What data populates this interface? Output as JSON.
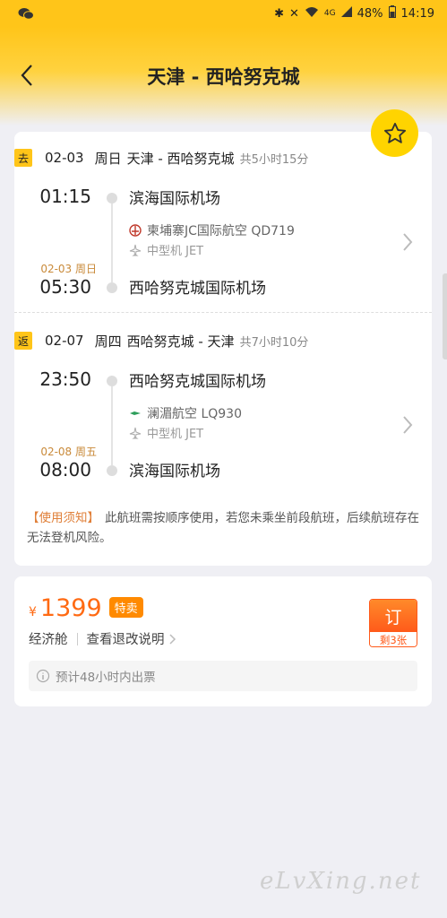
{
  "status_bar": {
    "battery": "48%",
    "time": "14:19",
    "network": "4G"
  },
  "header": {
    "title": "天津 - 西哈努克城"
  },
  "outbound": {
    "badge": "去",
    "date": "02-03",
    "weekday": "周日",
    "route": "天津 - 西哈努克城",
    "duration": "共5小时15分",
    "dep_time": "01:15",
    "dep_airport": "滨海国际机场",
    "airline": "柬埔寨JC国际航空 QD719",
    "aircraft": "中型机 JET",
    "arr_date": "02-03 周日",
    "arr_time": "05:30",
    "arr_airport": "西哈努克城国际机场"
  },
  "return": {
    "badge": "返",
    "date": "02-07",
    "weekday": "周四",
    "route": "西哈努克城 - 天津",
    "duration": "共7小时10分",
    "dep_time": "23:50",
    "dep_airport": "西哈努克城国际机场",
    "airline": "澜湄航空 LQ930",
    "aircraft": "中型机 JET",
    "arr_date": "02-08 周五",
    "arr_time": "08:00",
    "arr_airport": "滨海国际机场"
  },
  "notice": {
    "tag": "【使用须知】",
    "text": "此航班需按顺序使用，若您未乘坐前段航班，后续航班存在无法登机风险。"
  },
  "price": {
    "currency": "¥",
    "amount": "1399",
    "special_tag": "特卖",
    "cabin": "经济舱",
    "refund_link": "查看退改说明",
    "book_label": "订",
    "remaining": "剩3张",
    "ticket_note": "预计48小时内出票"
  },
  "watermark": "eLvXing.net",
  "colors": {
    "brand_yellow": "#ffc519",
    "price_orange": "#ff6a13",
    "book_red": "#ff5a1a"
  }
}
